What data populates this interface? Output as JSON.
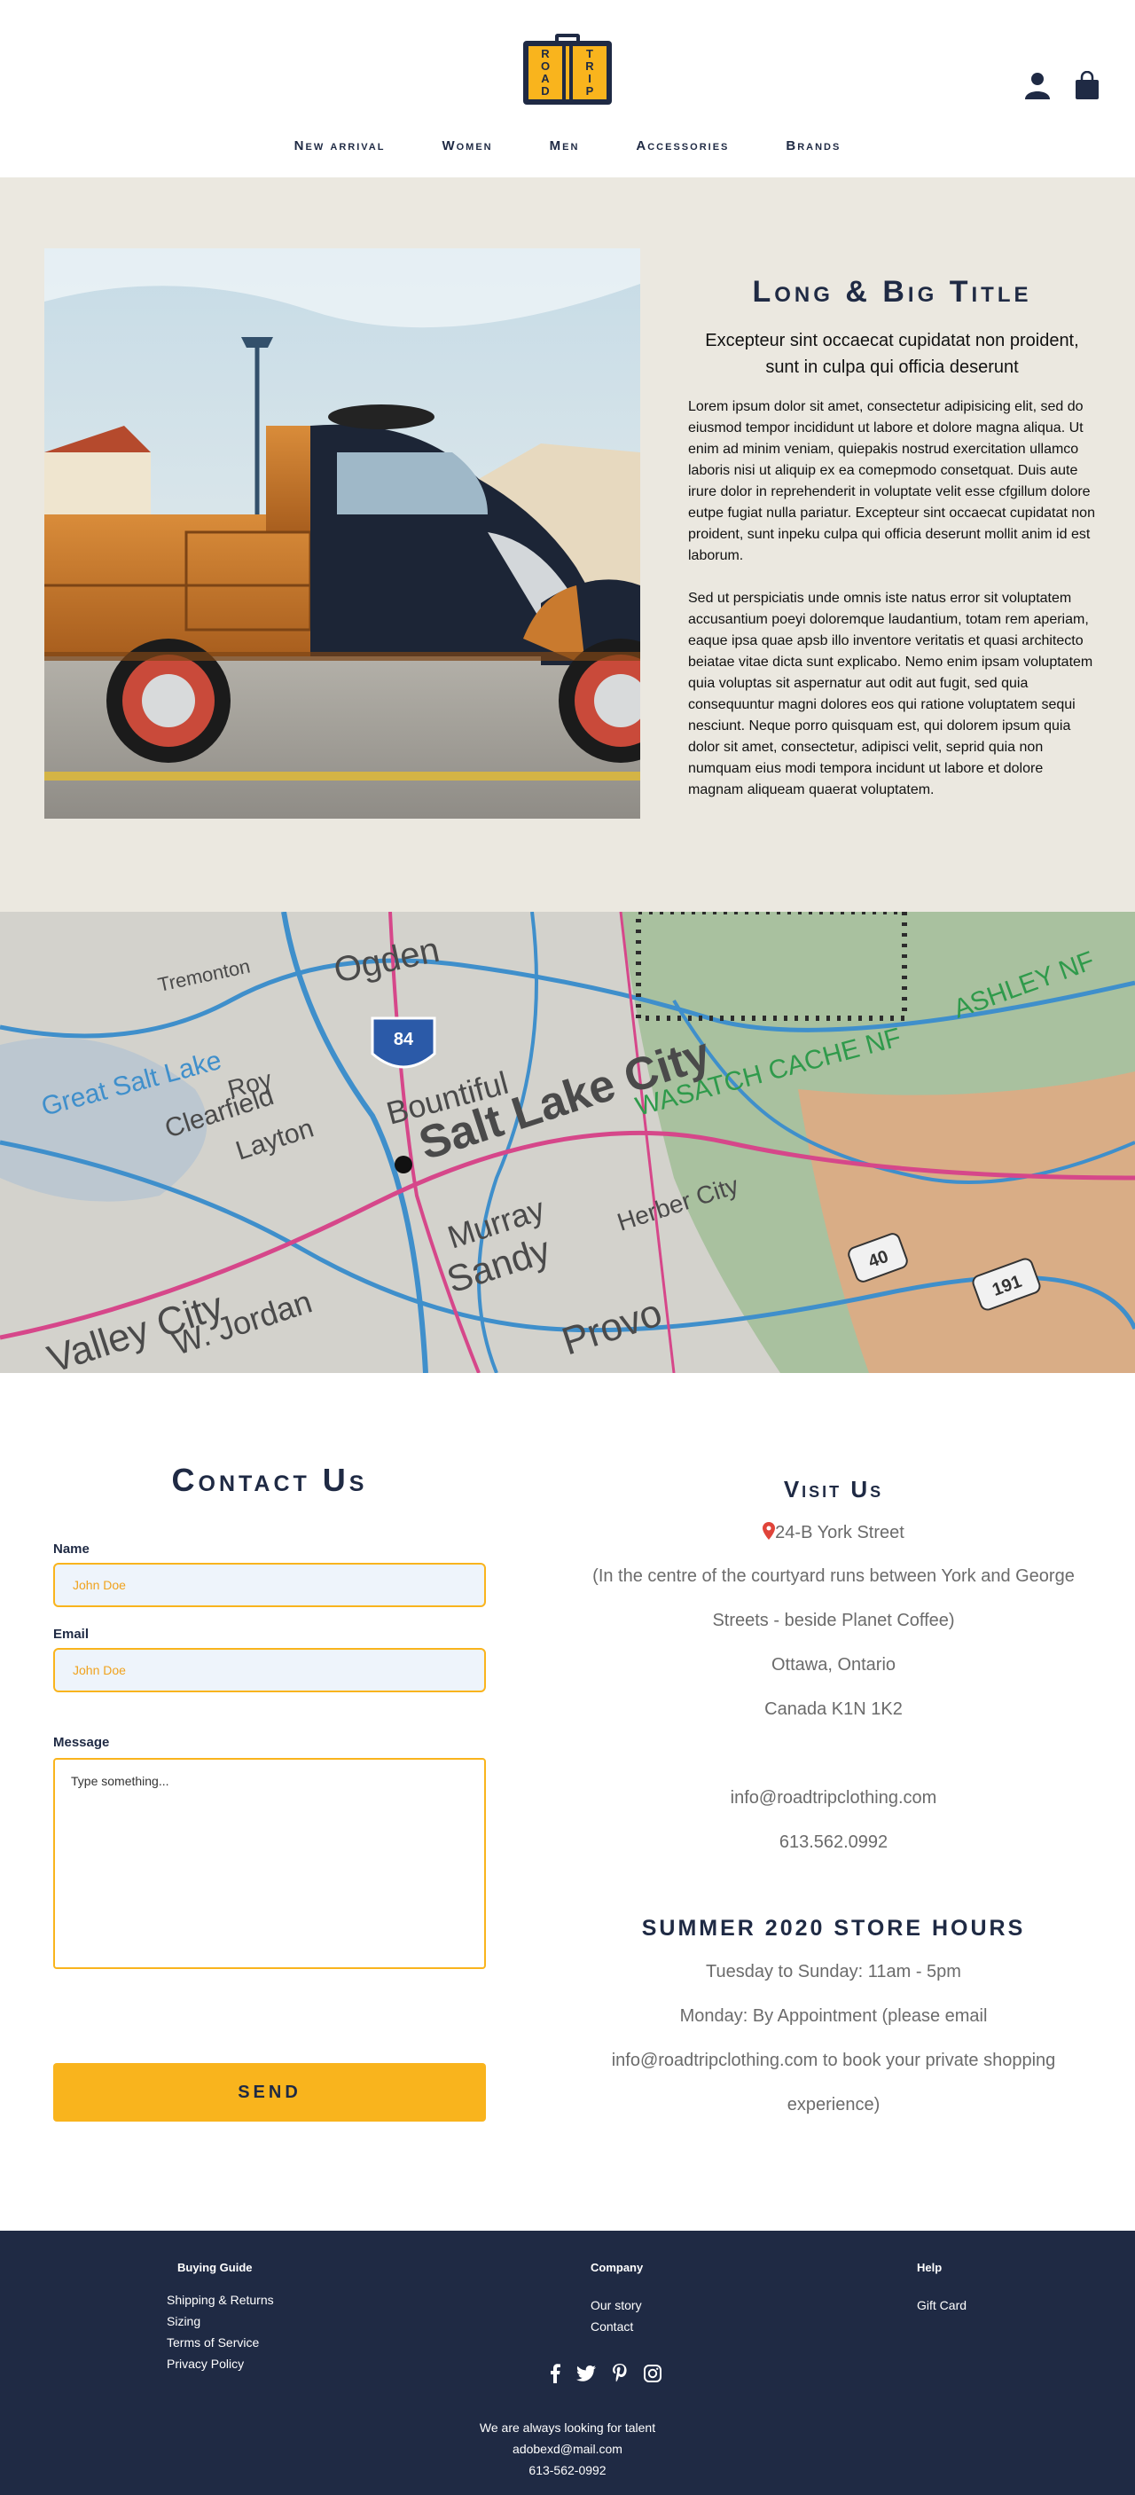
{
  "brand": {
    "logo_left": [
      "R",
      "O",
      "A",
      "D"
    ],
    "logo_right": [
      "T",
      "R",
      "I",
      "P"
    ],
    "colors": {
      "navy": "#1f2a44",
      "gold": "#f9b41d",
      "hero_bg": "#ebe8e0"
    }
  },
  "header": {
    "icons": [
      "user-icon",
      "shopping-bag-icon"
    ],
    "nav": [
      "New arrival",
      "Women",
      "Men",
      "Accessories",
      "Brands"
    ]
  },
  "hero": {
    "title": "Long & Big Title",
    "subtitle": "Excepteur sint occaecat cupidatat non proident, sunt in culpa qui officia deserunt",
    "paragraph1": "Lorem ipsum dolor sit amet, consectetur adipisicing elit, sed do eiusmod tempor incididunt ut labore et dolore magna aliqua. Ut enim ad minim veniam, quiepakis nostrud exercitation ullamco laboris nisi ut aliquip ex ea comepmodo consetquat. Duis aute irure dolor in reprehenderit in voluptate velit esse cfgillum dolore eutpe fugiat nulla pariatur. Excepteur sint occaecat cupidatat non proident, sunt inpeku culpa qui officia deserunt mollit anim id est laborum.",
    "paragraph2": "Sed ut perspiciatis unde omnis iste natus error sit voluptatem accusantium poeyi doloremque laudantium, totam rem aperiam, eaque ipsa quae apsb illo inventore veritatis et quasi architecto beiatae vitae dicta sunt explicabo. Nemo enim ipsam voluptatem quia voluptas sit aspernatur aut odit aut fugit, sed quia consequuntur magni dolores eos qui ratione voluptatem sequi nesciunt. Neque porro quisquam est, qui dolorem ipsum quia dolor sit amet, consectetur, adipisci velit, seprid quia non numquam eius modi tempora incidunt ut labore et dolore magnam aliqueam quaerat voluptatem."
  },
  "map": {
    "labels": [
      "Ogden",
      "Salt Lake City",
      "Bountiful",
      "Layton",
      "Roy",
      "Clearfield",
      "Great Salt Lake",
      "Tremonton",
      "Murray",
      "Sandy",
      "Herber City",
      "Provo",
      "Valley City",
      "W. Jordan",
      "WASATCH CACHE NF",
      "ASHLEY NF",
      "84",
      "40",
      "191"
    ]
  },
  "contact": {
    "title": "Contact Us",
    "name_label": "Name",
    "name_placeholder": "John Doe",
    "email_label": "Email",
    "email_placeholder": "John Doe",
    "message_label": "Message",
    "message_placeholder": "Type something...",
    "send_label": "SEND"
  },
  "visit": {
    "title": "Visit Us",
    "address": "24-B York Street",
    "lines": [
      "(In the centre of the courtyard runs between York and George",
      "Streets - beside Planet Coffee)",
      "Ottawa, Ontario",
      "Canada K1N 1K2"
    ],
    "email": "info@roadtripclothing.com",
    "phone": "613.562.0992",
    "hours_title": "SUMMER 2020 STORE HOURS",
    "hours_lines": [
      "Tuesday to Sunday: 11am - 5pm",
      "Monday: By Appointment (please email",
      "info@roadtripclothing.com to book your private shopping",
      "experience)"
    ]
  },
  "footer": {
    "buying_guide": {
      "title": "Buying Guide",
      "links": [
        "Shipping & Returns",
        "Sizing",
        "Terms of Service",
        "Privacy Policy"
      ]
    },
    "company": {
      "title": "Company",
      "links": [
        "Our story",
        "Contact"
      ]
    },
    "help": {
      "title": "Help",
      "links": [
        "Gift Card"
      ]
    },
    "social": [
      "facebook-icon",
      "twitter-icon",
      "pinterest-icon",
      "instagram-icon"
    ],
    "talent": "We are always looking for talent",
    "email": "adobexd@mail.com",
    "phone": "613-562-0992"
  }
}
